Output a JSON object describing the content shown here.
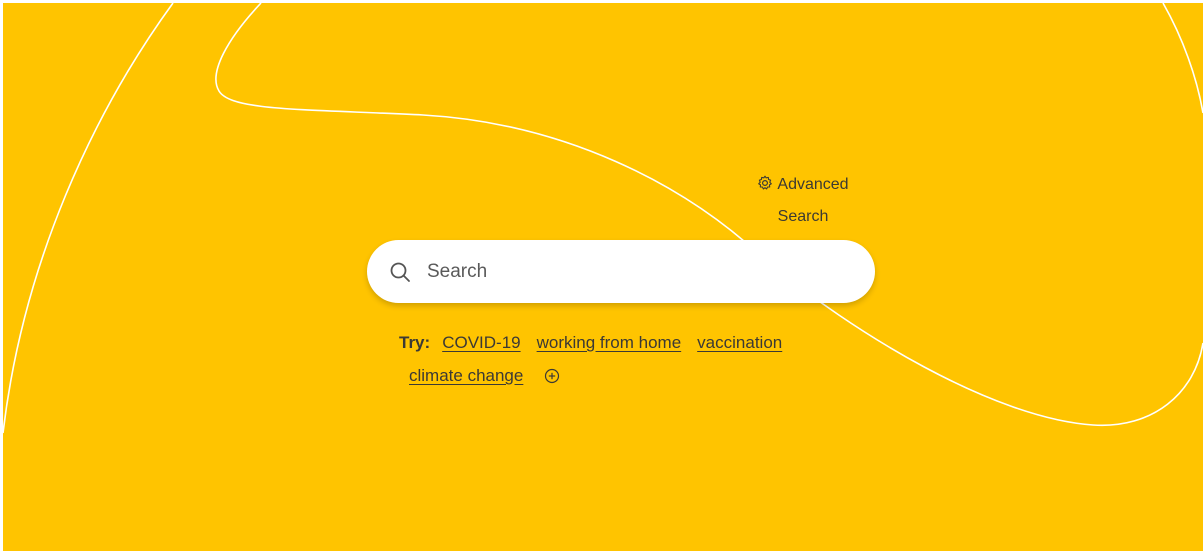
{
  "advanced_search": {
    "icon": "gear-icon",
    "label": "Advanced Search"
  },
  "search": {
    "icon": "search-icon",
    "placeholder": "Search",
    "value": ""
  },
  "suggestions": {
    "label": "Try:",
    "items": [
      "COVID-19",
      "working from home",
      "vaccination",
      "climate change"
    ],
    "more_icon": "plus-circle-icon"
  },
  "colors": {
    "background": "#ffc400",
    "line": "#ffffff",
    "text": "#3b3935"
  }
}
